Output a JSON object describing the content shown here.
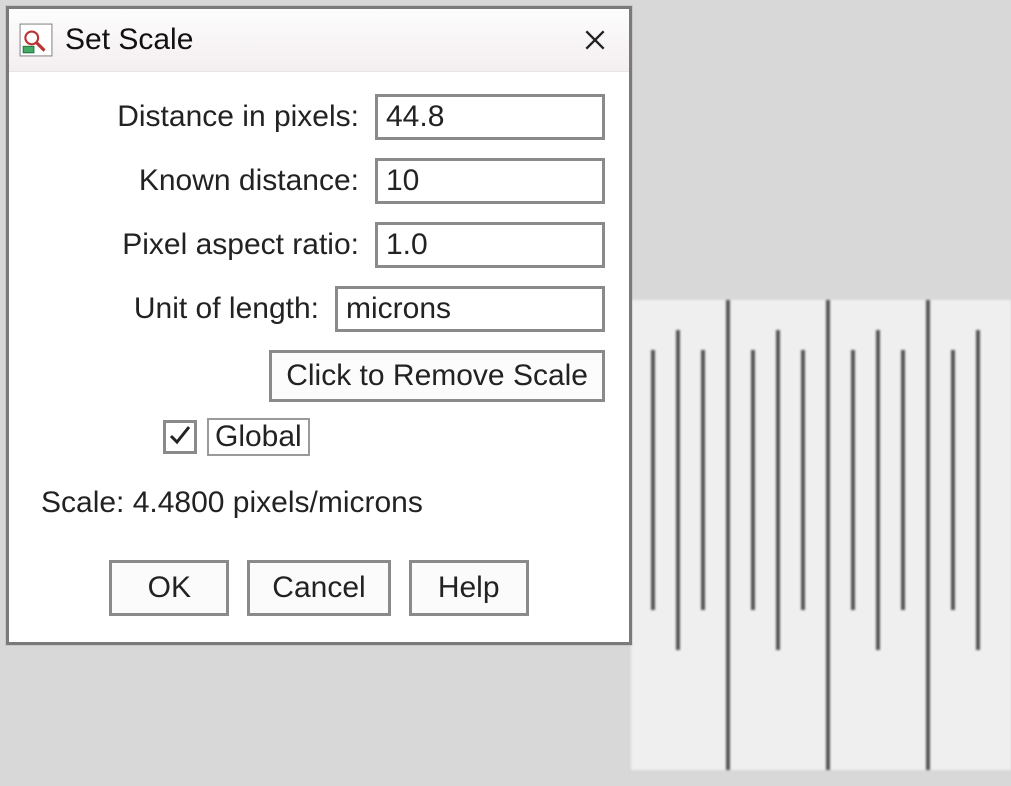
{
  "dialog": {
    "title": "Set Scale",
    "fields": {
      "distance_label": "Distance in pixels:",
      "distance_value": "44.8",
      "known_label": "Known distance:",
      "known_value": "10",
      "ratio_label": "Pixel aspect ratio:",
      "ratio_value": "1.0",
      "unit_label": "Unit of length:",
      "unit_value": "microns"
    },
    "remove_button": "Click to Remove Scale",
    "global_checkbox_label": "Global",
    "global_checked": true,
    "scale_readout": "Scale: 4.4800 pixels/microns",
    "buttons": {
      "ok": "OK",
      "cancel": "Cancel",
      "help": "Help"
    }
  }
}
